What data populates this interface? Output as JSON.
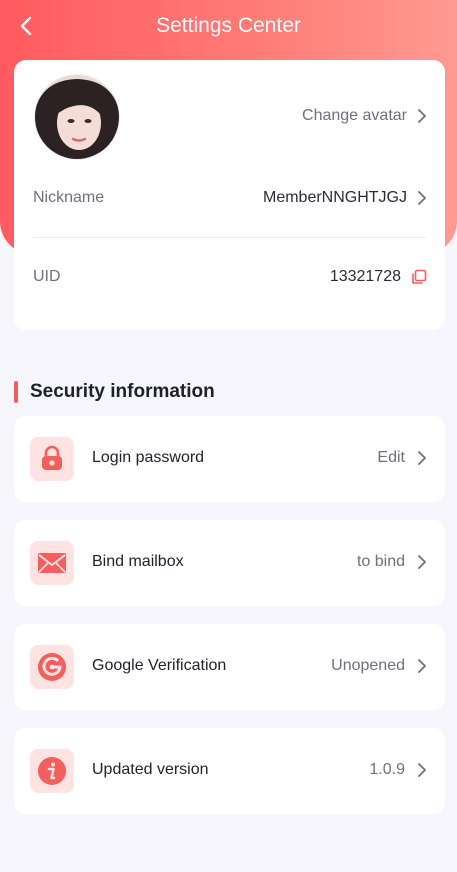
{
  "header": {
    "title": "Settings Center"
  },
  "profile": {
    "change_avatar_label": "Change avatar",
    "nickname_label": "Nickname",
    "nickname_value": "MemberNNGHTJGJ",
    "uid_label": "UID",
    "uid_value": "13321728"
  },
  "security": {
    "section_title": "Security information",
    "items": [
      {
        "label": "Login password",
        "value": "Edit",
        "icon": "lock-icon"
      },
      {
        "label": "Bind mailbox",
        "value": "to bind",
        "icon": "mail-icon"
      },
      {
        "label": "Google Verification",
        "value": "Unopened",
        "icon": "google-verification-icon"
      },
      {
        "label": "Updated version",
        "value": "1.0.9",
        "icon": "info-icon"
      }
    ]
  },
  "colors": {
    "accent": "#f25f5c",
    "icon_bg": "#ffe3e3",
    "header_start": "#ff5a5f",
    "header_end": "#ff9a92"
  }
}
